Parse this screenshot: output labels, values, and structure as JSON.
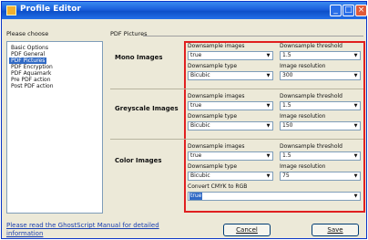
{
  "window": {
    "title": "Profile Editor",
    "controls": {
      "minimize": "_",
      "maximize": "□",
      "close": "×"
    }
  },
  "left_panel": {
    "heading": "Please choose",
    "items": [
      "Basic Options",
      "PDF General",
      "PDF Pictures",
      "PDF Encryption",
      "PDF Aquamark",
      "Pre PDF action",
      "Post PDF action"
    ],
    "selected_index": 2
  },
  "group_title": "PDF Pictures",
  "sections": [
    {
      "title": "Mono Images",
      "downsample_images_label": "Downsample images",
      "downsample_images": "true",
      "threshold_label": "Downsample threshold",
      "threshold": "1.5",
      "type_label": "Downsample type",
      "type": "Bicubic",
      "resolution_label": "Image resolution",
      "resolution": "300"
    },
    {
      "title": "Greyscale Images",
      "downsample_images_label": "Downsample images",
      "downsample_images": "true",
      "threshold_label": "Downsample threshold",
      "threshold": "1.5",
      "type_label": "Downsample type",
      "type": "Bicubic",
      "resolution_label": "Image resolution",
      "resolution": "150"
    },
    {
      "title": "Color Images",
      "downsample_images_label": "Downsample images",
      "downsample_images": "true",
      "threshold_label": "Downsample threshold",
      "threshold": "1.5",
      "type_label": "Downsample type",
      "type": "Bicubic",
      "resolution_label": "Image resolution",
      "resolution": "75",
      "convert_label": "Convert CMYK to RGB",
      "convert": "true"
    }
  ],
  "footer": {
    "link": "Please read the GhostScript Manual for detailed information",
    "cancel_button": "Cancel",
    "save_button": "Save"
  },
  "colors": {
    "highlight_border": "#e02020",
    "titlebar": "#1a5fdc",
    "selection": "#316ac5"
  }
}
